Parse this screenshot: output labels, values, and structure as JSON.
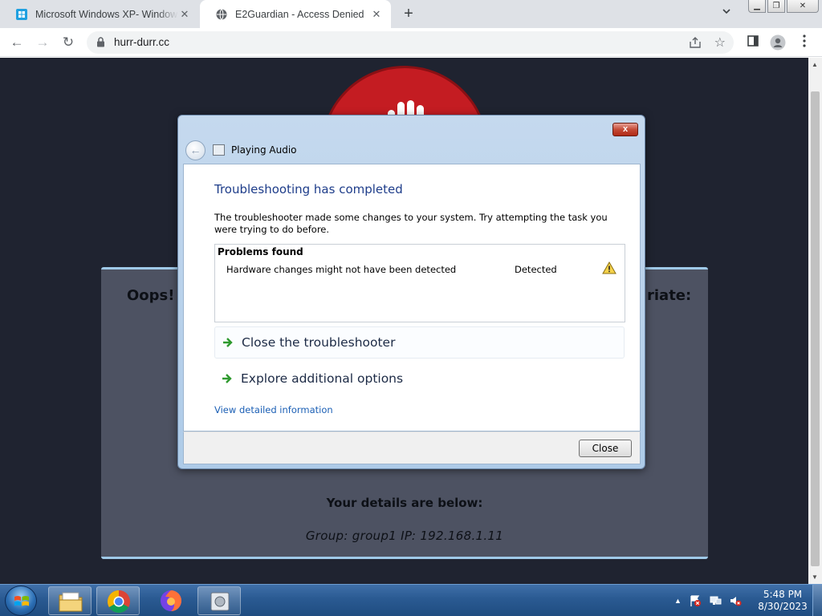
{
  "browser": {
    "tabs": [
      {
        "title": "Microsoft Windows XP- Windows",
        "icon": "windows-logo-icon",
        "active": false
      },
      {
        "title": "E2Guardian - Access Denied",
        "icon": "globe-icon",
        "active": true
      }
    ],
    "url": "hurr-durr.cc"
  },
  "page": {
    "oops_left": "Oops! Y",
    "oops_right": "riate:",
    "details_heading": "Your details are below:",
    "group_line": "Group: group1   IP: 192.168.1.11",
    "colors": {
      "background": "#1f2330",
      "panel": "#4d5262",
      "stop_sign": "#c41c22"
    }
  },
  "dialog": {
    "window_title": "Playing Audio",
    "heading": "Troubleshooting has completed",
    "description": "The troubleshooter made some changes to your system. Try attempting the task you were trying to do before.",
    "problems": {
      "header": "Problems found",
      "items": [
        {
          "name": "Hardware changes might not have been detected",
          "status": "Detected",
          "icon": "warning-icon"
        }
      ]
    },
    "options": [
      {
        "label": "Close the troubleshooter",
        "icon": "green-arrow-icon"
      },
      {
        "label": "Explore additional options",
        "icon": "green-arrow-icon"
      }
    ],
    "view_info_link": "View detailed information",
    "close_button": "Close",
    "close_caption": "x"
  },
  "taskbar": {
    "items": [
      {
        "name": "file-explorer",
        "icon": "folder-icon"
      },
      {
        "name": "chrome",
        "icon": "chrome-icon"
      },
      {
        "name": "firefox",
        "icon": "firefox-icon"
      },
      {
        "name": "troubleshooter",
        "icon": "troubleshooter-icon"
      }
    ],
    "clock_time": "5:48 PM",
    "clock_date": "8/30/2023"
  }
}
